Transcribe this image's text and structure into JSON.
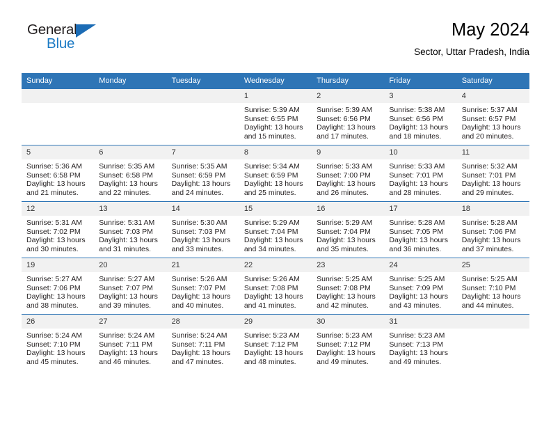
{
  "brand": {
    "name_part1": "General",
    "name_part2": "Blue",
    "triangle_color": "#1c6cb5",
    "blue_color": "#1c7ac4"
  },
  "header": {
    "title": "May 2024",
    "subtitle": "Sector, Uttar Pradesh, India"
  },
  "theme": {
    "header_band": "#2e75b6",
    "daynum_band": "#f1f1f1",
    "text": "#231f20"
  },
  "weekdays": [
    "Sunday",
    "Monday",
    "Tuesday",
    "Wednesday",
    "Thursday",
    "Friday",
    "Saturday"
  ],
  "weeks": [
    [
      {
        "day": "",
        "sunrise": "",
        "sunset": "",
        "daylight1": "",
        "daylight2": ""
      },
      {
        "day": "",
        "sunrise": "",
        "sunset": "",
        "daylight1": "",
        "daylight2": ""
      },
      {
        "day": "",
        "sunrise": "",
        "sunset": "",
        "daylight1": "",
        "daylight2": ""
      },
      {
        "day": "1",
        "sunrise": "Sunrise: 5:39 AM",
        "sunset": "Sunset: 6:55 PM",
        "daylight1": "Daylight: 13 hours",
        "daylight2": "and 15 minutes."
      },
      {
        "day": "2",
        "sunrise": "Sunrise: 5:39 AM",
        "sunset": "Sunset: 6:56 PM",
        "daylight1": "Daylight: 13 hours",
        "daylight2": "and 17 minutes."
      },
      {
        "day": "3",
        "sunrise": "Sunrise: 5:38 AM",
        "sunset": "Sunset: 6:56 PM",
        "daylight1": "Daylight: 13 hours",
        "daylight2": "and 18 minutes."
      },
      {
        "day": "4",
        "sunrise": "Sunrise: 5:37 AM",
        "sunset": "Sunset: 6:57 PM",
        "daylight1": "Daylight: 13 hours",
        "daylight2": "and 20 minutes."
      }
    ],
    [
      {
        "day": "5",
        "sunrise": "Sunrise: 5:36 AM",
        "sunset": "Sunset: 6:58 PM",
        "daylight1": "Daylight: 13 hours",
        "daylight2": "and 21 minutes."
      },
      {
        "day": "6",
        "sunrise": "Sunrise: 5:35 AM",
        "sunset": "Sunset: 6:58 PM",
        "daylight1": "Daylight: 13 hours",
        "daylight2": "and 22 minutes."
      },
      {
        "day": "7",
        "sunrise": "Sunrise: 5:35 AM",
        "sunset": "Sunset: 6:59 PM",
        "daylight1": "Daylight: 13 hours",
        "daylight2": "and 24 minutes."
      },
      {
        "day": "8",
        "sunrise": "Sunrise: 5:34 AM",
        "sunset": "Sunset: 6:59 PM",
        "daylight1": "Daylight: 13 hours",
        "daylight2": "and 25 minutes."
      },
      {
        "day": "9",
        "sunrise": "Sunrise: 5:33 AM",
        "sunset": "Sunset: 7:00 PM",
        "daylight1": "Daylight: 13 hours",
        "daylight2": "and 26 minutes."
      },
      {
        "day": "10",
        "sunrise": "Sunrise: 5:33 AM",
        "sunset": "Sunset: 7:01 PM",
        "daylight1": "Daylight: 13 hours",
        "daylight2": "and 28 minutes."
      },
      {
        "day": "11",
        "sunrise": "Sunrise: 5:32 AM",
        "sunset": "Sunset: 7:01 PM",
        "daylight1": "Daylight: 13 hours",
        "daylight2": "and 29 minutes."
      }
    ],
    [
      {
        "day": "12",
        "sunrise": "Sunrise: 5:31 AM",
        "sunset": "Sunset: 7:02 PM",
        "daylight1": "Daylight: 13 hours",
        "daylight2": "and 30 minutes."
      },
      {
        "day": "13",
        "sunrise": "Sunrise: 5:31 AM",
        "sunset": "Sunset: 7:03 PM",
        "daylight1": "Daylight: 13 hours",
        "daylight2": "and 31 minutes."
      },
      {
        "day": "14",
        "sunrise": "Sunrise: 5:30 AM",
        "sunset": "Sunset: 7:03 PM",
        "daylight1": "Daylight: 13 hours",
        "daylight2": "and 33 minutes."
      },
      {
        "day": "15",
        "sunrise": "Sunrise: 5:29 AM",
        "sunset": "Sunset: 7:04 PM",
        "daylight1": "Daylight: 13 hours",
        "daylight2": "and 34 minutes."
      },
      {
        "day": "16",
        "sunrise": "Sunrise: 5:29 AM",
        "sunset": "Sunset: 7:04 PM",
        "daylight1": "Daylight: 13 hours",
        "daylight2": "and 35 minutes."
      },
      {
        "day": "17",
        "sunrise": "Sunrise: 5:28 AM",
        "sunset": "Sunset: 7:05 PM",
        "daylight1": "Daylight: 13 hours",
        "daylight2": "and 36 minutes."
      },
      {
        "day": "18",
        "sunrise": "Sunrise: 5:28 AM",
        "sunset": "Sunset: 7:06 PM",
        "daylight1": "Daylight: 13 hours",
        "daylight2": "and 37 minutes."
      }
    ],
    [
      {
        "day": "19",
        "sunrise": "Sunrise: 5:27 AM",
        "sunset": "Sunset: 7:06 PM",
        "daylight1": "Daylight: 13 hours",
        "daylight2": "and 38 minutes."
      },
      {
        "day": "20",
        "sunrise": "Sunrise: 5:27 AM",
        "sunset": "Sunset: 7:07 PM",
        "daylight1": "Daylight: 13 hours",
        "daylight2": "and 39 minutes."
      },
      {
        "day": "21",
        "sunrise": "Sunrise: 5:26 AM",
        "sunset": "Sunset: 7:07 PM",
        "daylight1": "Daylight: 13 hours",
        "daylight2": "and 40 minutes."
      },
      {
        "day": "22",
        "sunrise": "Sunrise: 5:26 AM",
        "sunset": "Sunset: 7:08 PM",
        "daylight1": "Daylight: 13 hours",
        "daylight2": "and 41 minutes."
      },
      {
        "day": "23",
        "sunrise": "Sunrise: 5:25 AM",
        "sunset": "Sunset: 7:08 PM",
        "daylight1": "Daylight: 13 hours",
        "daylight2": "and 42 minutes."
      },
      {
        "day": "24",
        "sunrise": "Sunrise: 5:25 AM",
        "sunset": "Sunset: 7:09 PM",
        "daylight1": "Daylight: 13 hours",
        "daylight2": "and 43 minutes."
      },
      {
        "day": "25",
        "sunrise": "Sunrise: 5:25 AM",
        "sunset": "Sunset: 7:10 PM",
        "daylight1": "Daylight: 13 hours",
        "daylight2": "and 44 minutes."
      }
    ],
    [
      {
        "day": "26",
        "sunrise": "Sunrise: 5:24 AM",
        "sunset": "Sunset: 7:10 PM",
        "daylight1": "Daylight: 13 hours",
        "daylight2": "and 45 minutes."
      },
      {
        "day": "27",
        "sunrise": "Sunrise: 5:24 AM",
        "sunset": "Sunset: 7:11 PM",
        "daylight1": "Daylight: 13 hours",
        "daylight2": "and 46 minutes."
      },
      {
        "day": "28",
        "sunrise": "Sunrise: 5:24 AM",
        "sunset": "Sunset: 7:11 PM",
        "daylight1": "Daylight: 13 hours",
        "daylight2": "and 47 minutes."
      },
      {
        "day": "29",
        "sunrise": "Sunrise: 5:23 AM",
        "sunset": "Sunset: 7:12 PM",
        "daylight1": "Daylight: 13 hours",
        "daylight2": "and 48 minutes."
      },
      {
        "day": "30",
        "sunrise": "Sunrise: 5:23 AM",
        "sunset": "Sunset: 7:12 PM",
        "daylight1": "Daylight: 13 hours",
        "daylight2": "and 49 minutes."
      },
      {
        "day": "31",
        "sunrise": "Sunrise: 5:23 AM",
        "sunset": "Sunset: 7:13 PM",
        "daylight1": "Daylight: 13 hours",
        "daylight2": "and 49 minutes."
      },
      {
        "day": "",
        "sunrise": "",
        "sunset": "",
        "daylight1": "",
        "daylight2": ""
      }
    ]
  ]
}
